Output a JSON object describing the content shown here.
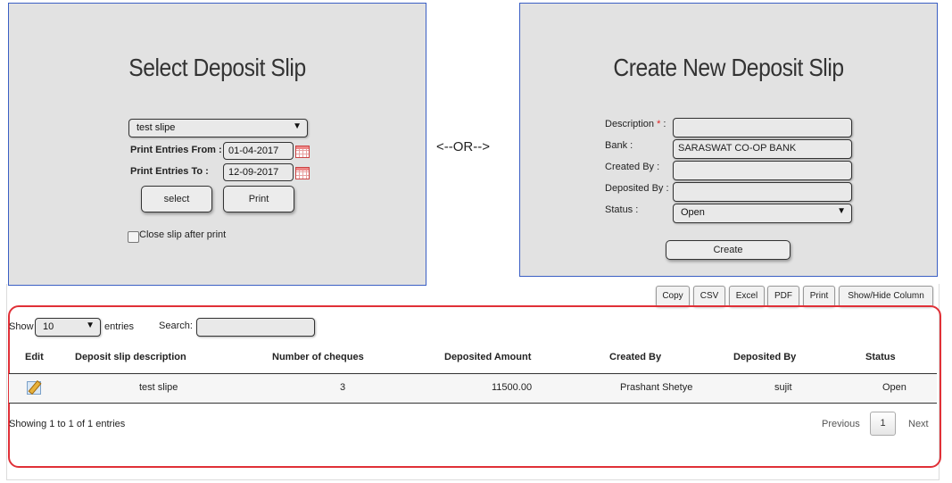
{
  "select_panel": {
    "title": "Select Deposit Slip",
    "slip_select": "test slipe",
    "from_label": "Print Entries From :",
    "from_value": "01-04-2017",
    "to_label": "Print Entries To :",
    "to_value": "12-09-2017",
    "select_button": "select",
    "print_button": "Print",
    "close_checkbox_label": "Close slip after print"
  },
  "or_text": "<--OR-->",
  "create_panel": {
    "title": "Create New Deposit Slip",
    "description_label": "Description",
    "required_mark": "*",
    "colon": " :",
    "description_value": "",
    "bank_label": "Bank :",
    "bank_value": "SARASWAT CO-OP BANK",
    "created_by_label": "Created By :",
    "created_by_value": "",
    "deposited_by_label": "Deposited By :",
    "deposited_by_value": "",
    "status_label": "Status :",
    "status_value": "Open",
    "create_button": "Create"
  },
  "toolbar": {
    "copy": "Copy",
    "csv": "CSV",
    "excel": "Excel",
    "pdf": "PDF",
    "print": "Print",
    "show_hide": "Show/Hide Column"
  },
  "table": {
    "show_label": "Show",
    "entries_value": "10",
    "entries_label": "entries",
    "search_label": "Search:",
    "search_value": "",
    "columns": [
      "Edit",
      "Deposit slip description",
      "Number of cheques",
      "Deposited Amount",
      "Created By",
      "Deposited By",
      "Status"
    ],
    "rows": [
      {
        "description": "test slipe",
        "cheques": "3",
        "amount": "11500.00",
        "created_by": "Prashant Shetye",
        "deposited_by": "sujit",
        "status": "Open"
      }
    ],
    "info": "Showing 1 to 1 of 1 entries",
    "prev": "Previous",
    "page": "1",
    "next": "Next"
  },
  "colors": {
    "panel_bg": "#e2e2e2",
    "panel_border": "#3b5fc4",
    "highlight_border": "#e03037",
    "required": "#e02020"
  }
}
